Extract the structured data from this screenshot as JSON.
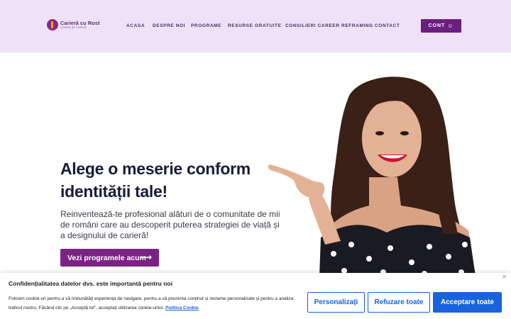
{
  "header": {
    "logo_title": "Carieră cu Rost",
    "logo_subtitle": "Centrul de Carieră",
    "nav": [
      "ACASA",
      "DESPRE NOI",
      "PROGRAME",
      "RESURSE GRATUITE",
      "CONSILIERI CAREER REFRAMING",
      "CONTACT"
    ],
    "account_label": "CONT",
    "account_icon": "smile-icon"
  },
  "hero": {
    "title_line1": "Alege o meserie conform",
    "title_line2": "identității tale!",
    "description": "Reinventează-te profesional alături de o comunitate de mii de români care au descoperit puterea strategiei de viață și a designului de carieră!",
    "cta_label": "Vezi programele acum",
    "cta_icon": "arrow-right-icon"
  },
  "cookie_banner": {
    "title": "Confidențialitatea datelor dvs. este importantă pentru noi",
    "text": "Folosim cookie-uri pentru a vă îmbunătăți experiența de navigare, pentru a vă prezenta conținut și reclame personalizate și pentru a analiza traficul nostru. Făcând clic pe „Acceptă tot”, acceptați utilizarea cookie-urilor.",
    "policy_link": "Politica Cookie",
    "customize_label": "Personalizați",
    "reject_label": "Refuzare toate",
    "accept_label": "Acceptare toate",
    "close_icon": "close-icon"
  },
  "colors": {
    "header_bg": "#efe2f6",
    "brand_purple": "#6b1e7e",
    "cta_purple": "#7b2384",
    "cookie_blue": "#1863dc"
  }
}
